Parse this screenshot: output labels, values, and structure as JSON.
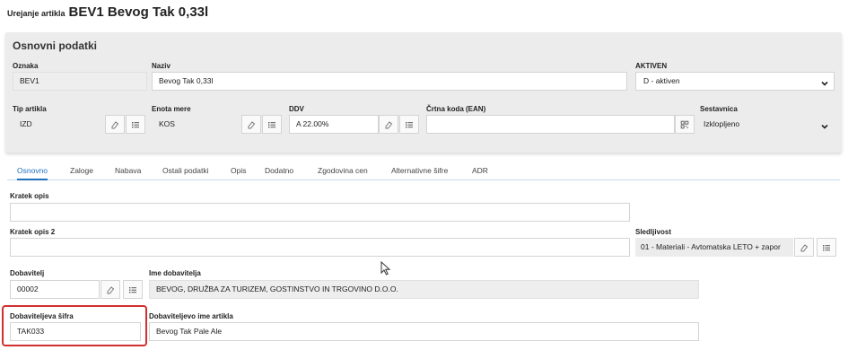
{
  "heading": {
    "prefix": "Urejanje artikla",
    "title": "BEV1 Bevog Tak 0,33l"
  },
  "panel": {
    "title": "Osnovni podatki",
    "oznaka": {
      "label": "Oznaka",
      "value": "BEV1"
    },
    "naziv": {
      "label": "Naziv",
      "value": "Bevog Tak 0,33l"
    },
    "aktiven": {
      "label": "AKTIVEN",
      "value": "D - aktiven"
    },
    "tip_artikla": {
      "label": "Tip artikla",
      "value": "IZD"
    },
    "enota_mere": {
      "label": "Enota mere",
      "value": "KOS"
    },
    "ddv": {
      "label": "DDV",
      "value": "A 22.00%"
    },
    "crtna_koda": {
      "label": "Črtna koda (EAN)",
      "value": ""
    },
    "sestavnica": {
      "label": "Sestavnica",
      "value": "Izklopljeno"
    }
  },
  "tabs": [
    {
      "label": "Osnovno",
      "active": true
    },
    {
      "label": "Zaloge"
    },
    {
      "label": "Nabava"
    },
    {
      "label": "Ostali podatki"
    },
    {
      "label": "Opis"
    },
    {
      "label": "Dodatno"
    },
    {
      "label": "Zgodovina cen"
    },
    {
      "label": "Alternativne šifre"
    },
    {
      "label": "ADR"
    }
  ],
  "form": {
    "kratek_opis": {
      "label": "Kratek opis",
      "value": ""
    },
    "kratek_opis_2": {
      "label": "Kratek opis 2",
      "value": ""
    },
    "sledljivost": {
      "label": "Sledljivost",
      "value": "01 - Materiali - Avtomatska LETO + zapor"
    },
    "dobavitelj": {
      "label": "Dobavitelj",
      "value": "00002"
    },
    "ime_dobavitelja": {
      "label": "Ime dobavitelja",
      "value": "BEVOG, DRUŽBA ZA TURIZEM, GOSTINSTVO IN TRGOVINO D.O.O."
    },
    "dobaviteljeva_sifra": {
      "label": "Dobaviteljeva šifra",
      "value": "TAK033"
    },
    "dobaviteljevo_ime": {
      "label": "Dobaviteljevo ime artikla",
      "value": "Bevog Tak Pale Ale"
    }
  },
  "icons": {
    "eraser": "eraser-icon",
    "list": "list-icon",
    "barcode": "barcode-icon",
    "chevron": "chevron-down-icon",
    "cursor": "mouse-pointer-icon"
  },
  "colors": {
    "accent": "#1f6fc0",
    "highlight": "#d22f2f",
    "panel": "#ececec"
  }
}
